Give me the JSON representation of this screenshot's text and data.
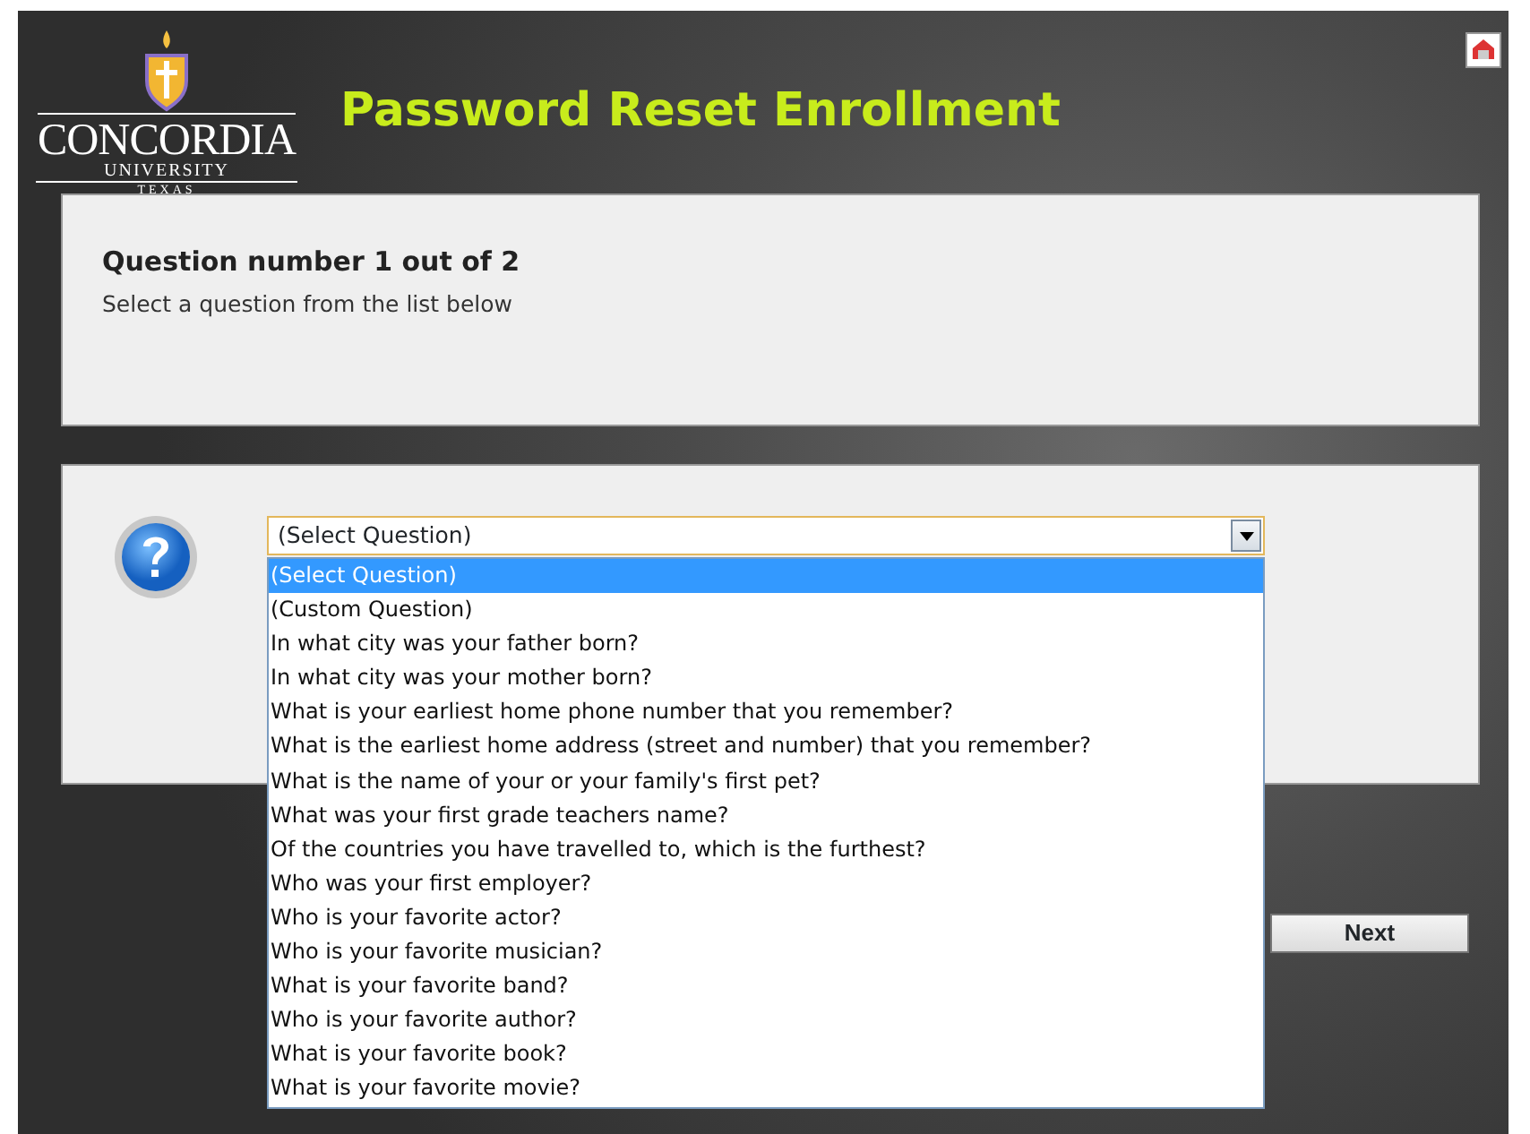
{
  "logo": {
    "name": "CONCORDIA",
    "subtitle": "UNIVERSITY",
    "place": "TEXAS"
  },
  "title": "Password Reset Enrollment",
  "question_panel": {
    "heading": "Question number 1 out of 2",
    "instruction": "Select a question from the list below"
  },
  "question_select": {
    "value": "(Select Question)",
    "expanded": true,
    "options": [
      {
        "label": "(Select Question)",
        "selected": true
      },
      {
        "label": "(Custom Question)",
        "selected": false
      },
      {
        "label": "In what city was your father born?",
        "selected": false
      },
      {
        "label": "In what city was your mother born?",
        "selected": false
      },
      {
        "label": "What is your earliest home phone number that you remember?",
        "selected": false
      },
      {
        "label": "What is the earliest home address (street and number) that you remember?",
        "selected": false
      },
      {
        "label": "What is the name of your or your family's first pet?",
        "selected": false
      },
      {
        "label": "What was your first grade teachers name?",
        "selected": false
      },
      {
        "label": "Of the countries you have travelled to, which is the furthest?",
        "selected": false
      },
      {
        "label": "Who was your first employer?",
        "selected": false
      },
      {
        "label": "Who is your favorite actor?",
        "selected": false
      },
      {
        "label": "Who is your favorite musician?",
        "selected": false
      },
      {
        "label": "What is your favorite band?",
        "selected": false
      },
      {
        "label": "Who is your favorite author?",
        "selected": false
      },
      {
        "label": "What is your favorite book?",
        "selected": false
      },
      {
        "label": "What is your favorite movie?",
        "selected": false
      }
    ]
  },
  "buttons": [
    {
      "label": "Next"
    }
  ]
}
